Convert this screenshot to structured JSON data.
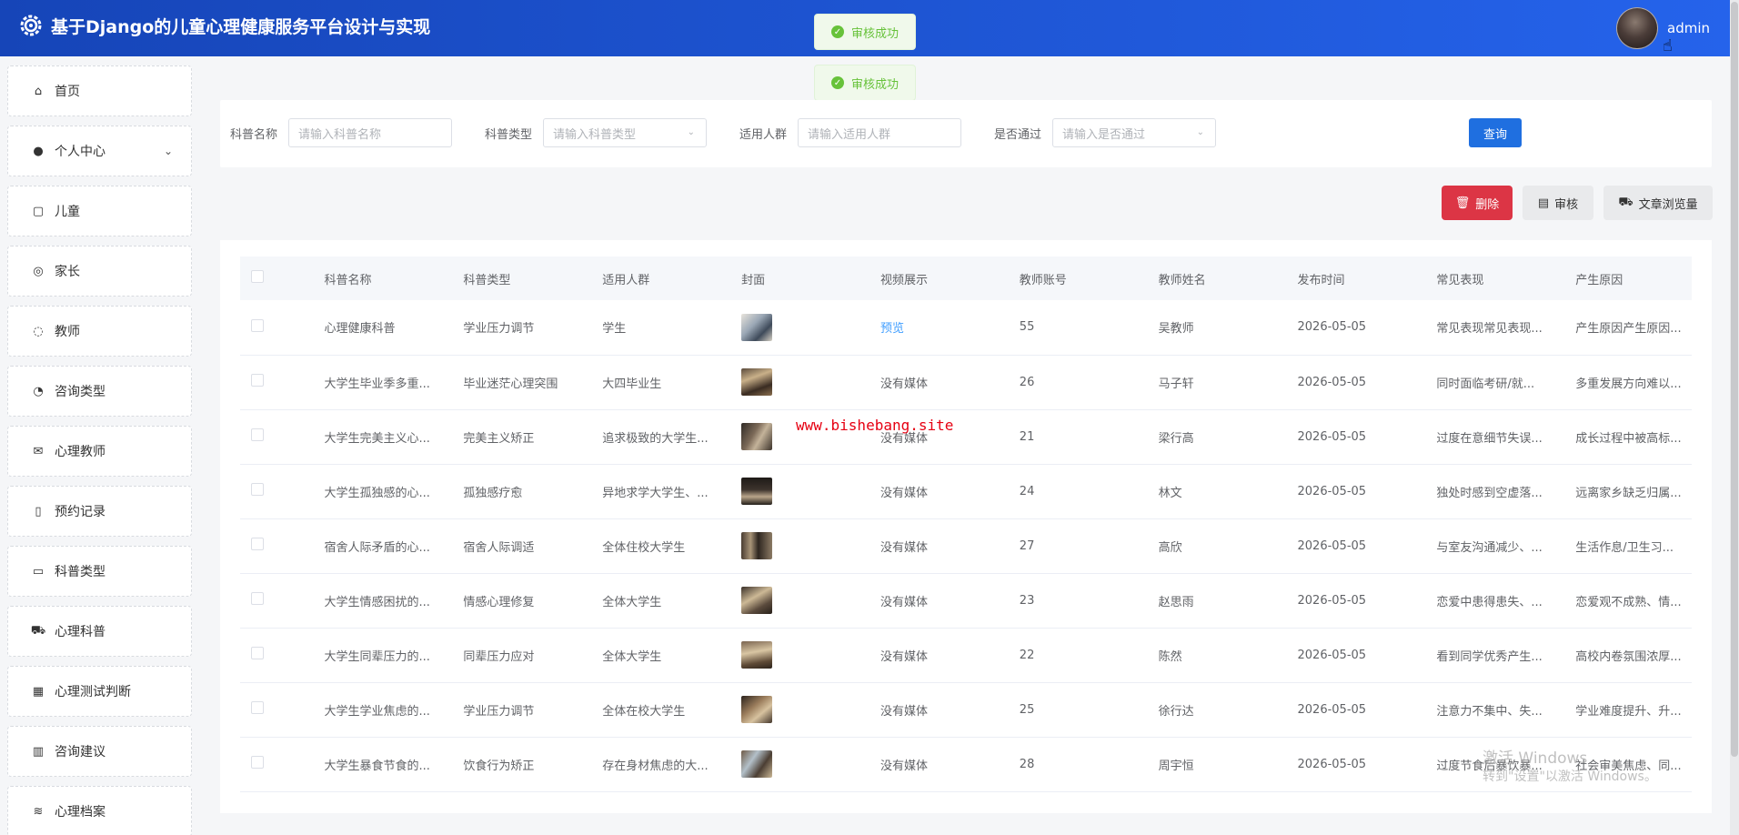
{
  "header": {
    "title": "基于Django的儿童心理健康服务平台设计与实现",
    "username": "admin"
  },
  "toasts": [
    "审核成功",
    "审核成功"
  ],
  "sidebar": {
    "items": [
      {
        "label": "首页",
        "icon": "home-icon"
      },
      {
        "label": "个人中心",
        "icon": "user-icon",
        "expandable": true
      },
      {
        "label": "儿童",
        "icon": "child-icon"
      },
      {
        "label": "家长",
        "icon": "parent-icon"
      },
      {
        "label": "教师",
        "icon": "chat-icon"
      },
      {
        "label": "咨询类型",
        "icon": "pie-chart-icon"
      },
      {
        "label": "心理教师",
        "icon": "mail-icon"
      },
      {
        "label": "预约记录",
        "icon": "notebook-icon"
      },
      {
        "label": "科普类型",
        "icon": "id-card-icon"
      },
      {
        "label": "心理科普",
        "icon": "cart-icon"
      },
      {
        "label": "心理测试判断",
        "icon": "building-icon"
      },
      {
        "label": "咨询建议",
        "icon": "office-icon"
      },
      {
        "label": "心理档案",
        "icon": "database-icon"
      }
    ]
  },
  "search": {
    "name_label": "科普名称",
    "name_placeholder": "请输入科普名称",
    "type_label": "科普类型",
    "type_placeholder": "请输入科普类型",
    "audience_label": "适用人群",
    "audience_placeholder": "请输入适用人群",
    "passed_label": "是否通过",
    "passed_placeholder": "请输入是否通过",
    "query_label": "查询"
  },
  "actions": {
    "delete_label": "删除",
    "audit_label": "审核",
    "stats_label": "文章浏览量"
  },
  "table": {
    "columns": [
      "科普名称",
      "科普类型",
      "适用人群",
      "封面",
      "视频展示",
      "教师账号",
      "教师姓名",
      "发布时间",
      "常见表现",
      "产生原因"
    ],
    "rows": [
      {
        "name": "心理健康科普",
        "type": "学业压力调节",
        "audience": "学生",
        "video": "预览",
        "account": "55",
        "teacher": "吴教师",
        "date": "2026-05-05",
        "symptom": "常见表现常见表现...",
        "cause": "产生原因产生原因..."
      },
      {
        "name": "大学生毕业季多重...",
        "type": "毕业迷茫心理突围",
        "audience": "大四毕业生",
        "video": "没有媒体",
        "account": "26",
        "teacher": "马子轩",
        "date": "2026-05-05",
        "symptom": "同时面临考研/就...",
        "cause": "多重发展方向难以..."
      },
      {
        "name": "大学生完美主义心...",
        "type": "完美主义矫正",
        "audience": "追求极致的大学生...",
        "video": "没有媒体",
        "account": "21",
        "teacher": "梁行高",
        "date": "2026-05-05",
        "symptom": "过度在意细节失误...",
        "cause": "成长过程中被高标..."
      },
      {
        "name": "大学生孤独感的心...",
        "type": "孤独感疗愈",
        "audience": "异地求学大学生、...",
        "video": "没有媒体",
        "account": "24",
        "teacher": "林文",
        "date": "2026-05-05",
        "symptom": "独处时感到空虚落...",
        "cause": "远离家乡缺乏归属..."
      },
      {
        "name": "宿舍人际矛盾的心...",
        "type": "宿舍人际调适",
        "audience": "全体住校大学生",
        "video": "没有媒体",
        "account": "27",
        "teacher": "高欣",
        "date": "2026-05-05",
        "symptom": "与室友沟通减少、...",
        "cause": "生活作息/卫生习..."
      },
      {
        "name": "大学生情感困扰的...",
        "type": "情感心理修复",
        "audience": "全体大学生",
        "video": "没有媒体",
        "account": "23",
        "teacher": "赵思雨",
        "date": "2026-05-05",
        "symptom": "恋爱中患得患失、...",
        "cause": "恋爱观不成熟、情..."
      },
      {
        "name": "大学生同辈压力的...",
        "type": "同辈压力应对",
        "audience": "全体大学生",
        "video": "没有媒体",
        "account": "22",
        "teacher": "陈然",
        "date": "2026-05-05",
        "symptom": "看到同学优秀产生...",
        "cause": "高校内卷氛围浓厚..."
      },
      {
        "name": "大学生学业焦虑的...",
        "type": "学业压力调节",
        "audience": "全体在校大学生",
        "video": "没有媒体",
        "account": "25",
        "teacher": "徐行达",
        "date": "2026-05-05",
        "symptom": "注意力不集中、失...",
        "cause": "学业难度提升、升..."
      },
      {
        "name": "大学生暴食节食的...",
        "type": "饮食行为矫正",
        "audience": "存在身材焦虑的大...",
        "video": "没有媒体",
        "account": "28",
        "teacher": "周宇恒",
        "date": "2026-05-05",
        "symptom": "过度节食后暴饮暴...",
        "cause": "社会审美焦虑、同..."
      }
    ]
  },
  "overlays": {
    "watermark": "www.bishebang.site",
    "windows_line1": "激活 Windows",
    "windows_line2": "转到\"设置\"以激活 Windows。"
  },
  "colors": {
    "header_start": "#1645b8",
    "header_end": "#2563eb",
    "primary": "#1f6fe0",
    "danger": "#dc3545",
    "success": "#67c23a",
    "link": "#409eff"
  }
}
